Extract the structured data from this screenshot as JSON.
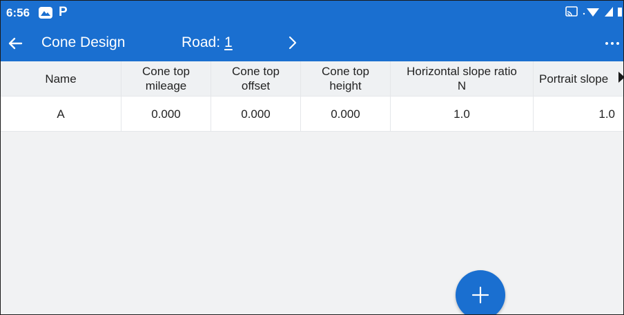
{
  "status_bar": {
    "time": "6:56",
    "icons": [
      "gallery-icon",
      "parking-app-icon",
      "cast-icon",
      "wifi-icon",
      "signal-icon",
      "battery-icon"
    ]
  },
  "app_bar": {
    "title": "Cone Design",
    "road_label": "Road:",
    "road_value": "1",
    "icons": [
      "back-arrow-icon",
      "chevron-right-icon",
      "more-vert-icon"
    ]
  },
  "table": {
    "columns": [
      "Name",
      "Cone top\nmileage",
      "Cone top\noffset",
      "Cone top\nheight",
      "Horizontal slope ratio\nN",
      "Portrait slope"
    ],
    "rows": [
      [
        "A",
        "0.000",
        "0.000",
        "0.000",
        "1.0",
        "1.0"
      ]
    ]
  },
  "fab": {
    "icon": "plus-icon"
  },
  "colors": {
    "primary": "#1a6fd0",
    "background": "#f1f2f3",
    "header_row": "#eff1f3",
    "border": "#e4e6e9"
  }
}
